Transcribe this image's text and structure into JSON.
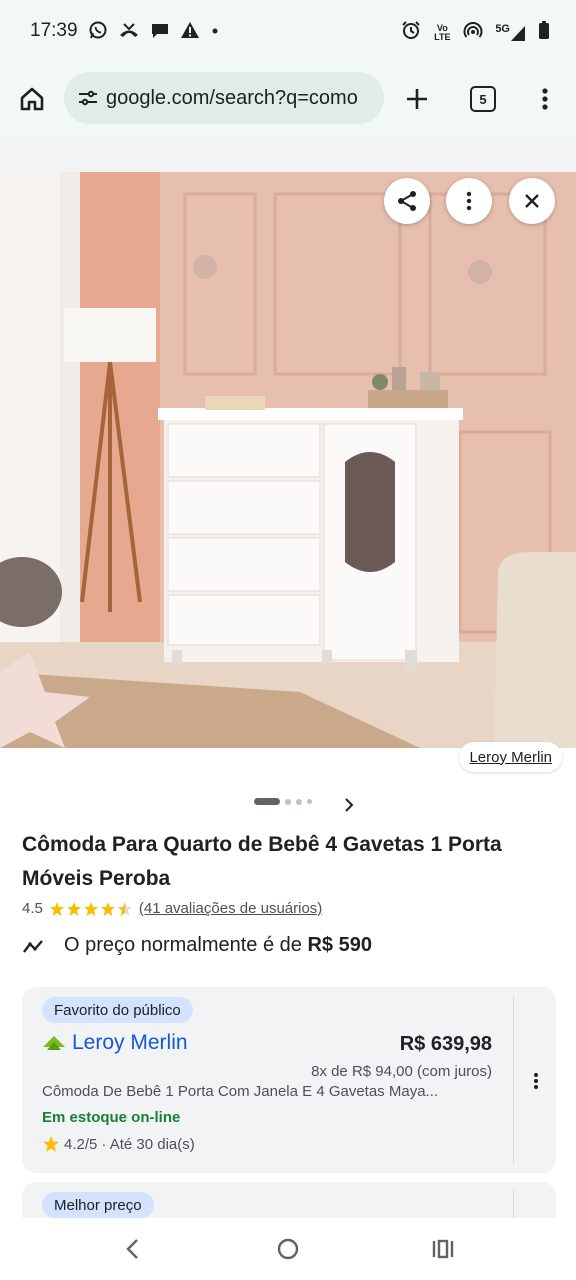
{
  "status_bar": {
    "time": "17:39",
    "left_icons": [
      "whatsapp-icon",
      "missed-call-icon",
      "chat-icon",
      "warning-icon",
      "dot-icon"
    ],
    "right_icons": [
      "alarm-icon",
      "volte-icon",
      "hotspot-icon",
      "5g-signal-icon",
      "battery-icon"
    ],
    "network": "5G",
    "volte": "Vo LTE"
  },
  "browser": {
    "url": "google.com/search?q=como",
    "tab_count": "5"
  },
  "image": {
    "source": "Leroy Merlin",
    "page_count": 4,
    "active_page": 1
  },
  "product": {
    "title": "Cômoda Para Quarto de Bebê 4 Gavetas 1 Porta Móveis Peroba",
    "rating": "4.5",
    "rating_value": 4.5,
    "reviews": "(41 avaliações de usuários)",
    "price_text": "O preço normalmente é de",
    "price_value": "R$ 590"
  },
  "offers": [
    {
      "badge": "Favorito do público",
      "merchant": "Leroy Merlin",
      "price": "R$ 639,98",
      "installments": "8x de R$ 94,00 (com juros)",
      "description": "Cômoda De Bebê 1 Porta Com Janela E 4 Gavetas Maya...",
      "stock": "Em estoque on-line",
      "seller_rating": "4.2/5",
      "delivery": "· Até 30 dia(s)"
    },
    {
      "badge": "Melhor preço"
    }
  ],
  "colors": {
    "accent": "#1558d6",
    "stock_green": "#188038",
    "star": "#fbbc04",
    "badge_bg": "#d3e3fd",
    "merchant_logo": "#78be20"
  }
}
